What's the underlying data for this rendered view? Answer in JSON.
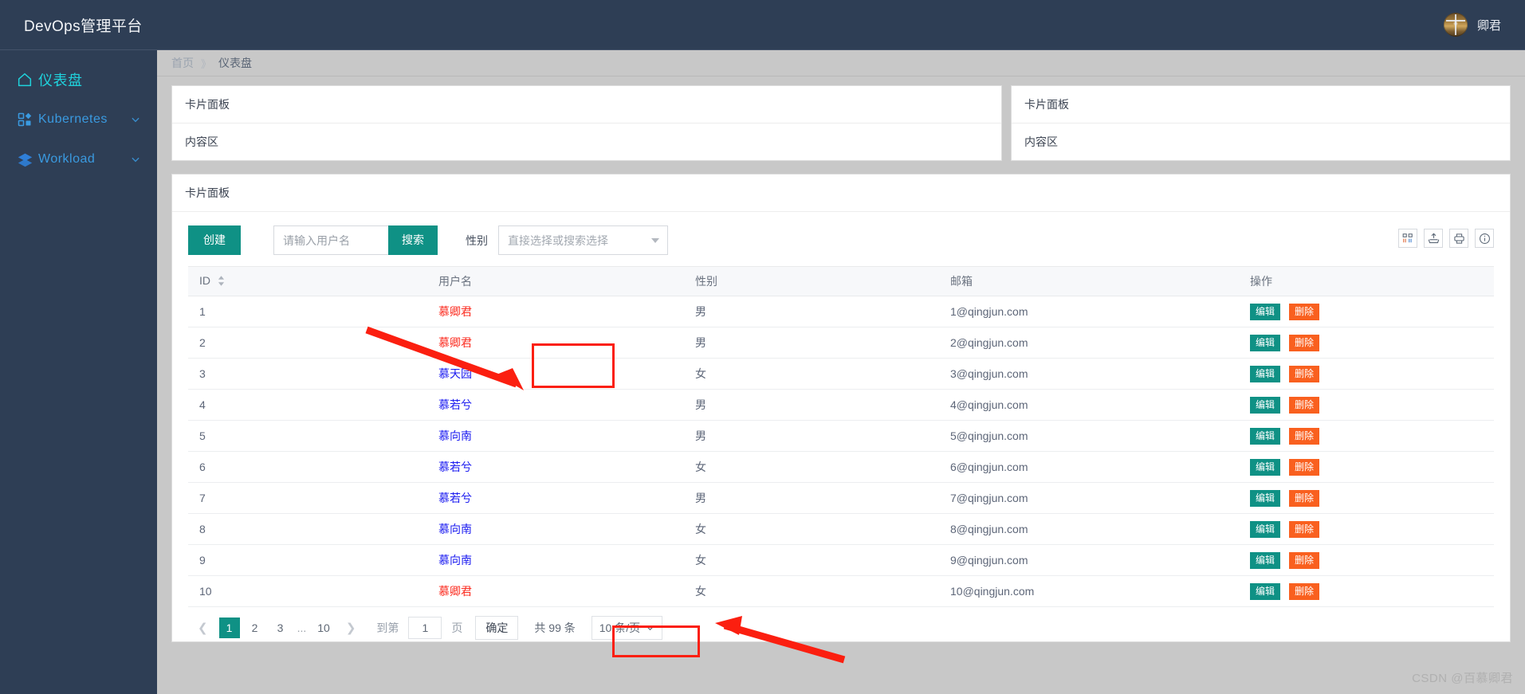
{
  "header": {
    "brand": "DevOps管理平台",
    "user_name": "卿君",
    "avatar_icon": "user-avatar"
  },
  "sidebar": {
    "items": [
      {
        "label": "仪表盘",
        "icon": "home-icon",
        "active": true,
        "expandable": false
      },
      {
        "label": "Kubernetes",
        "icon": "grid-apps-icon",
        "active": false,
        "expandable": true
      },
      {
        "label": "Workload",
        "icon": "layers-icon",
        "active": false,
        "expandable": true
      }
    ]
  },
  "breadcrumb": {
    "home": "首页",
    "separator": "》",
    "current": "仪表盘"
  },
  "cards": {
    "top_left": {
      "title": "卡片面板",
      "body": "内容区"
    },
    "top_right": {
      "title": "卡片面板",
      "body": "内容区"
    },
    "main": {
      "title": "卡片面板"
    }
  },
  "toolbar": {
    "create_label": "创建",
    "search_placeholder": "请输入用户名",
    "search_value": "",
    "search_label": "搜索",
    "filter_label": "性别",
    "select_placeholder": "直接选择或搜索选择",
    "icons": [
      "columns-icon",
      "export-icon",
      "print-icon",
      "info-icon"
    ]
  },
  "table": {
    "columns": [
      {
        "key": "id",
        "label": "ID",
        "sortable": true
      },
      {
        "key": "name",
        "label": "用户名",
        "sortable": false
      },
      {
        "key": "gender",
        "label": "性别",
        "sortable": false
      },
      {
        "key": "email",
        "label": "邮箱",
        "sortable": false
      },
      {
        "key": "ops",
        "label": "操作",
        "sortable": false
      }
    ],
    "row_actions": {
      "edit": "编辑",
      "delete": "删除"
    },
    "rows": [
      {
        "id": "1",
        "name": "慕卿君",
        "highlight": true,
        "gender": "男",
        "email": "1@qingjun.com"
      },
      {
        "id": "2",
        "name": "慕卿君",
        "highlight": true,
        "gender": "男",
        "email": "2@qingjun.com"
      },
      {
        "id": "3",
        "name": "慕天园",
        "highlight": false,
        "gender": "女",
        "email": "3@qingjun.com"
      },
      {
        "id": "4",
        "name": "慕若兮",
        "highlight": false,
        "gender": "男",
        "email": "4@qingjun.com"
      },
      {
        "id": "5",
        "name": "慕向南",
        "highlight": false,
        "gender": "男",
        "email": "5@qingjun.com"
      },
      {
        "id": "6",
        "name": "慕若兮",
        "highlight": false,
        "gender": "女",
        "email": "6@qingjun.com"
      },
      {
        "id": "7",
        "name": "慕若兮",
        "highlight": false,
        "gender": "男",
        "email": "7@qingjun.com"
      },
      {
        "id": "8",
        "name": "慕向南",
        "highlight": false,
        "gender": "女",
        "email": "8@qingjun.com"
      },
      {
        "id": "9",
        "name": "慕向南",
        "highlight": false,
        "gender": "女",
        "email": "9@qingjun.com"
      },
      {
        "id": "10",
        "name": "慕卿君",
        "highlight": true,
        "gender": "女",
        "email": "10@qingjun.com"
      }
    ]
  },
  "pagination": {
    "prev_icon": "chevron-left-icon",
    "next_icon": "chevron-right-icon",
    "pages": [
      "1",
      "2",
      "3"
    ],
    "ellipsis": "...",
    "last_page": "10",
    "current_page": "1",
    "jump_label": "到第",
    "jump_value": "1",
    "page_unit": "页",
    "confirm_label": "确定",
    "total_label": "共 99 条",
    "page_size_label": "10 条/页"
  },
  "annotations": {
    "highlight_color": "#fb1f10",
    "boxes": [
      "rows-1-2-username",
      "row-10-username"
    ],
    "arrows": [
      "arrow-to-rows-1-2",
      "arrow-to-row-10"
    ]
  },
  "watermark": "CSDN @百慕卿君",
  "colors": {
    "sidebar_bg": "#2e3e55",
    "primary": "#0f9185",
    "danger": "#f9601f",
    "link": "#1a1af0",
    "active_nav": "#1fd3dd",
    "nav": "#3a9ae0"
  }
}
